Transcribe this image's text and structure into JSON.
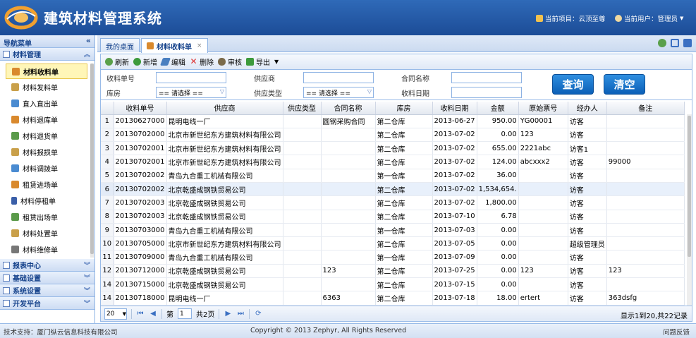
{
  "header": {
    "title": "建筑材料管理系统",
    "project_label": "当前项目：云顶至尊",
    "user_label": "当前用户：管理员",
    "user_arrow": "▼"
  },
  "sidebar": {
    "title": "导航菜单",
    "collapse": "«",
    "active_group": "材料管理",
    "active_group_chev": "︽",
    "items": [
      {
        "label": "材料收料单",
        "color": "#d9892d"
      },
      {
        "label": "材料发料单",
        "color": "#c9a04a"
      },
      {
        "label": "直入直出单",
        "color": "#4a8bd1"
      },
      {
        "label": "材料退库单",
        "color": "#d9892d"
      },
      {
        "label": "材料退货单",
        "color": "#5a9a4a"
      },
      {
        "label": "材料报损单",
        "color": "#c9a04a"
      },
      {
        "label": "材料调拨单",
        "color": "#4a8bd1"
      },
      {
        "label": "租赁进场单",
        "color": "#d9892d"
      },
      {
        "label": "材料停租单",
        "color": "#3a5fa8"
      },
      {
        "label": "租赁出场单",
        "color": "#5a9a4a"
      },
      {
        "label": "材料处置单",
        "color": "#c9a04a"
      },
      {
        "label": "材料维修单",
        "color": "#777777"
      }
    ],
    "groups": [
      {
        "label": "报表中心",
        "chev": "︾"
      },
      {
        "label": "基础设置",
        "chev": "︾"
      },
      {
        "label": "系统设置",
        "chev": "︾"
      },
      {
        "label": "开发平台",
        "chev": "︾"
      }
    ]
  },
  "tabs": {
    "desk": "我的桌面",
    "active": "材料收料单",
    "close": "×"
  },
  "toolbar": {
    "refresh": "刷新",
    "add": "新增",
    "edit": "编辑",
    "delete": "删除",
    "audit": "审核",
    "export": "导出",
    "export_arrow": "▼"
  },
  "form": {
    "order_no_label": "收料单号",
    "supplier_label": "供应商",
    "contract_label": "合同名称",
    "warehouse_label": "库房",
    "supplier_type_label": "供应类型",
    "date_label": "收料日期",
    "select_placeholder": "== 请选择 ==",
    "select_arrow": "▽",
    "query_btn": "查询",
    "clear_btn": "清空"
  },
  "grid": {
    "columns": [
      "收料单号",
      "供应商",
      "供应类型",
      "合同名称",
      "库房",
      "收料日期",
      "金额",
      "原始票号",
      "经办人",
      "备注"
    ],
    "rows": [
      [
        "1",
        "20130627000",
        "昆明电线一厂",
        "",
        "圆钢采购合同",
        "第二仓库",
        "2013-06-27",
        "950.00",
        "YG00001",
        "访客",
        ""
      ],
      [
        "2",
        "20130702000",
        "北京市新世纪东方建筑材料有限公司",
        "",
        "",
        "第二仓库",
        "2013-07-02",
        "0.00",
        "123",
        "访客",
        ""
      ],
      [
        "3",
        "20130702001",
        "北京市新世纪东方建筑材料有限公司",
        "",
        "",
        "第二仓库",
        "2013-07-02",
        "655.00",
        "2221abc",
        "访客1",
        ""
      ],
      [
        "4",
        "20130702001",
        "北京市新世纪东方建筑材料有限公司",
        "",
        "",
        "第二仓库",
        "2013-07-02",
        "124.00",
        "abcxxx2",
        "访客",
        "99000"
      ],
      [
        "5",
        "20130702002",
        "青岛九合重工机械有限公司",
        "",
        "",
        "第一仓库",
        "2013-07-02",
        "36.00",
        "",
        "访客",
        ""
      ],
      [
        "6",
        "20130702002",
        "北京乾盛成钢铁贸易公司",
        "",
        "",
        "第二仓库",
        "2013-07-02",
        "1,534,654.",
        "",
        "访客",
        ""
      ],
      [
        "7",
        "20130702003",
        "北京乾盛成钢铁贸易公司",
        "",
        "",
        "第二仓库",
        "2013-07-02",
        "1,800.00",
        "",
        "访客",
        ""
      ],
      [
        "8",
        "20130702003",
        "北京乾盛成钢铁贸易公司",
        "",
        "",
        "第二仓库",
        "2013-07-10",
        "6.78",
        "",
        "访客",
        ""
      ],
      [
        "9",
        "20130703000",
        "青岛九合重工机械有限公司",
        "",
        "",
        "第一仓库",
        "2013-07-03",
        "0.00",
        "",
        "访客",
        ""
      ],
      [
        "10",
        "20130705000",
        "北京市新世纪东方建筑材料有限公司",
        "",
        "",
        "第二仓库",
        "2013-07-05",
        "0.00",
        "",
        "超级管理员",
        ""
      ],
      [
        "11",
        "20130709000",
        "青岛九合重工机械有限公司",
        "",
        "",
        "第一仓库",
        "2013-07-09",
        "0.00",
        "",
        "访客",
        ""
      ],
      [
        "12",
        "20130712000",
        "北京乾盛成钢铁贸易公司",
        "",
        "123",
        "第二仓库",
        "2013-07-25",
        "0.00",
        "123",
        "访客",
        "123"
      ],
      [
        "14",
        "20130715000",
        "北京乾盛成钢铁贸易公司",
        "",
        "",
        "第二仓库",
        "2013-07-15",
        "0.00",
        "",
        "访客",
        ""
      ],
      [
        "14",
        "20130718000",
        "昆明电线一厂",
        "",
        "6363",
        "第二仓库",
        "2013-07-18",
        "18.00",
        "ertert",
        "访客",
        "363dsfg"
      ]
    ]
  },
  "pager": {
    "size": "20",
    "size_arrow": "▼",
    "page_prefix": "第",
    "page": "1",
    "page_suffix": "共2页",
    "first": "⏮",
    "prev": "◀",
    "next": "▶",
    "last": "⏭",
    "reload": "⟳",
    "info": "显示1到20,共22记录"
  },
  "footer": {
    "support": "技术支持：厦门纵云信息科技有限公司",
    "copyright": "Copyright © 2013 Zephyr, All Rights Reserved",
    "feedback": "问题反馈"
  },
  "colors": {
    "header": "#1c4c97",
    "accent": "#15428b",
    "button": "#0b5fb7"
  }
}
